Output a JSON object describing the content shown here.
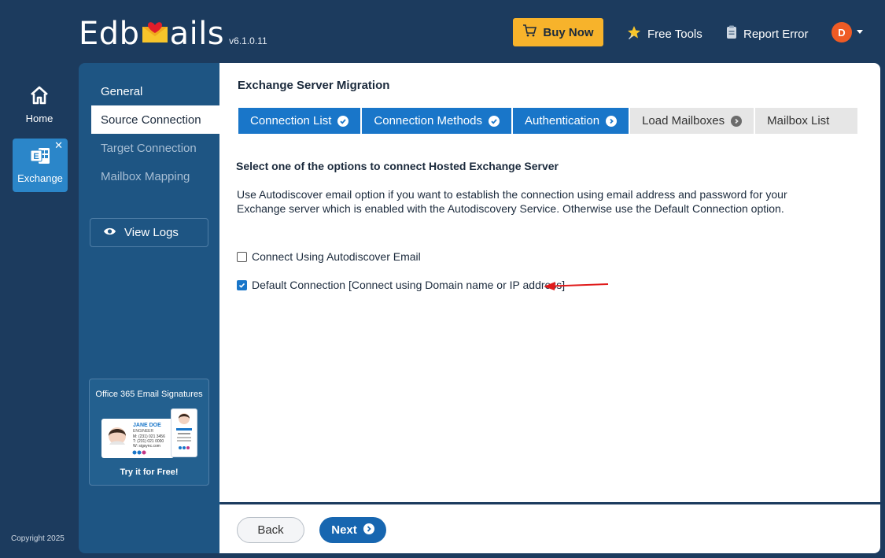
{
  "header": {
    "logo_prefix": "Edb",
    "logo_suffix": "ails",
    "version": "v6.1.0.11",
    "buy_now": "Buy Now",
    "free_tools": "Free Tools",
    "report_error": "Report Error",
    "avatar_initial": "D",
    "accent": "#f7b32b"
  },
  "rail": {
    "home": "Home",
    "exchange": "Exchange",
    "close": "✕",
    "copyright": "Copyright 2025"
  },
  "subnav": {
    "items": [
      "General",
      "Source Connection",
      "Target Connection",
      "Mailbox Mapping"
    ],
    "active_index": 1,
    "view_logs": "View Logs",
    "promo": {
      "title": "Office 365 Email Signatures",
      "name": "JANE DOE",
      "role": "ENGINEER",
      "phone_m": "M: (231) 021 3456",
      "phone_t": "T: (231) 021 0000",
      "web": "W: sigsync.com",
      "cta": "Try it for Free!"
    }
  },
  "main": {
    "title": "Exchange Server Migration",
    "steps": [
      {
        "label": "Connection List",
        "state": "done"
      },
      {
        "label": "Connection Methods",
        "state": "done"
      },
      {
        "label": "Authentication",
        "state": "current"
      },
      {
        "label": "Load Mailboxes",
        "state": "todo"
      },
      {
        "label": "Mailbox List",
        "state": "todo"
      }
    ],
    "heading": "Select one of the options to connect Hosted Exchange Server",
    "description_line1": "Use Autodiscover email option if you want to establish the connection using email address and password for your",
    "description_line2": "Exchange server which is enabled with the Autodiscovery Service. Otherwise use the Default Connection option.",
    "option_autodiscover": "Connect Using Autodiscover Email",
    "option_autodiscover_checked": false,
    "option_default": "Default Connection [Connect using Domain name or IP address]",
    "option_default_checked": true
  },
  "footer": {
    "back": "Back",
    "next": "Next"
  },
  "colors": {
    "background": "#1c3b5e",
    "subnav": "#1e5583",
    "primary": "#1976c9",
    "arrow": "#e01b1b"
  }
}
